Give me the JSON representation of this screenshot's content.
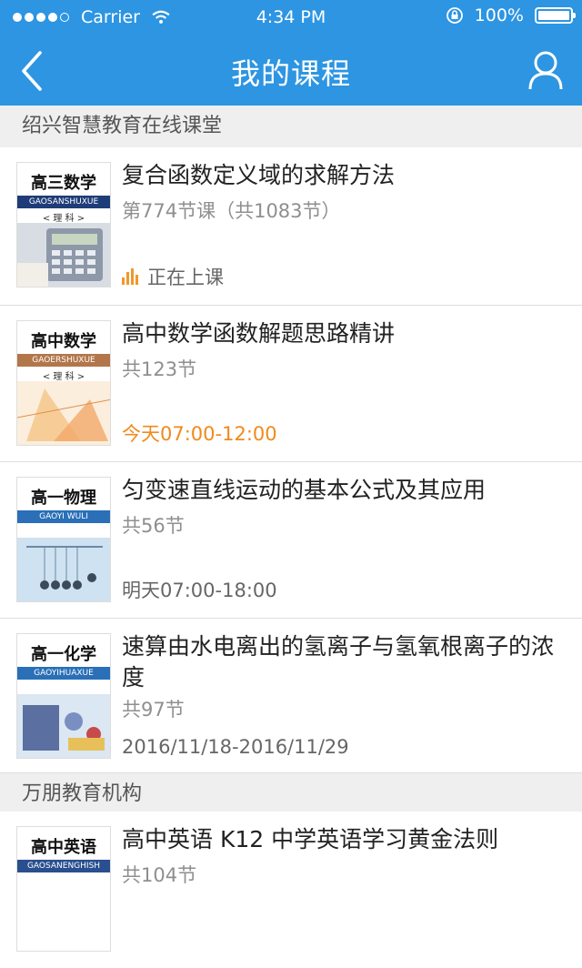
{
  "status_bar": {
    "carrier": "Carrier",
    "time": "4:34 PM",
    "battery": "100%"
  },
  "nav": {
    "title": "我的课程"
  },
  "sections": [
    {
      "name": "绍兴智慧教育在线课堂"
    },
    {
      "name": "万朋教育机构"
    }
  ],
  "courses": [
    {
      "cover_title": "高三数学",
      "cover_pinyin": "GAOSANSHUXUE",
      "cover_sub": "< 理 科 >",
      "title": "复合函数定义域的求解方法",
      "meta": "第774节课（共1083节）",
      "status": "正在上课"
    },
    {
      "cover_title": "高中数学",
      "cover_pinyin": "GAOERSHUXUE",
      "cover_sub": "< 理 科 >",
      "title": "高中数学函数解题思路精讲",
      "meta": "共123节",
      "status": "今天07:00-12:00"
    },
    {
      "cover_title": "高一物理",
      "cover_pinyin": "GAOYI WULI",
      "cover_sub": "",
      "title": "匀变速直线运动的基本公式及其应用",
      "meta": "共56节",
      "status": "明天07:00-18:00"
    },
    {
      "cover_title": "高一化学",
      "cover_pinyin": "GAOYIHUAXUE",
      "cover_sub": "",
      "title": "速算由水电离出的氢离子与氢氧根离子的浓度",
      "meta": "共97节",
      "status": "2016/11/18-2016/11/29"
    },
    {
      "cover_title": "高中英语",
      "cover_pinyin": "GAOSANENGHISH",
      "cover_sub": "",
      "title": "高中英语 K12 中学英语学习黄金法则",
      "meta": "共104节",
      "status": ""
    }
  ],
  "colors": {
    "header": "#2d95e2",
    "accent_orange": "#f08a1c"
  },
  "icons": {
    "back": "chevron-left-icon",
    "user": "user-icon",
    "live": "bar-chart-icon"
  }
}
